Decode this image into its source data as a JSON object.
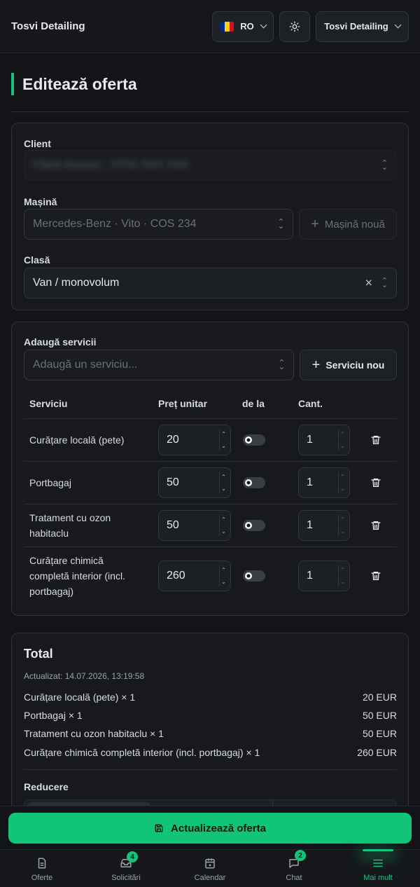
{
  "header": {
    "brand": "Tosvi Detailing",
    "language": "RO",
    "account": "Tosvi Detailing",
    "flag_colors": [
      "#002b7f",
      "#fcd116",
      "#ce1126"
    ]
  },
  "page_title": "Editează oferta",
  "vehicle_card": {
    "client_label": "Client",
    "client_value": "Client Ascuns · 07XX XXX XXX",
    "car_label": "Mașină",
    "car_value": "Mercedes-Benz · Vito · COS 234",
    "new_car_label": "Mașină nouă",
    "class_label": "Clasă",
    "class_value": "Van / monovolum"
  },
  "services_card": {
    "add_label": "Adaugă servicii",
    "add_placeholder": "Adaugă un serviciu...",
    "new_service_label": "Serviciu nou",
    "columns": {
      "service": "Serviciu",
      "unit_price": "Preț unitar",
      "from": "de la",
      "qty": "Cant."
    },
    "rows": [
      {
        "name": "Curățare locală (pete)",
        "price": "20",
        "qty": "1"
      },
      {
        "name": "Portbagaj",
        "price": "50",
        "qty": "1"
      },
      {
        "name": "Tratament cu ozon habitaclu",
        "price": "50",
        "qty": "1"
      },
      {
        "name": "Curățare chimică completă interior (incl. portbagaj)",
        "price": "260",
        "qty": "1"
      }
    ]
  },
  "total_card": {
    "title": "Total",
    "updated": "Actualizat: 14.07.2026, 13:19:58",
    "lines": [
      {
        "label": "Curățare locală (pete) × 1",
        "amount": "20 EUR"
      },
      {
        "label": "Portbagaj × 1",
        "amount": "50 EUR"
      },
      {
        "label": "Tratament cu ozon habitaclu × 1",
        "amount": "50 EUR"
      },
      {
        "label": "Curățare chimică completă interior (incl. portbagaj) × 1",
        "amount": "260 EUR"
      }
    ],
    "discount_label": "Reducere"
  },
  "primary_action": "Actualizează oferta",
  "nav": [
    {
      "label": "Oferte",
      "badge": ""
    },
    {
      "label": "Solicitări",
      "badge": "4"
    },
    {
      "label": "Calendar",
      "badge": ""
    },
    {
      "label": "Chat",
      "badge": "2"
    },
    {
      "label": "Mai mult",
      "badge": ""
    }
  ],
  "accent_color": "#16c47f"
}
